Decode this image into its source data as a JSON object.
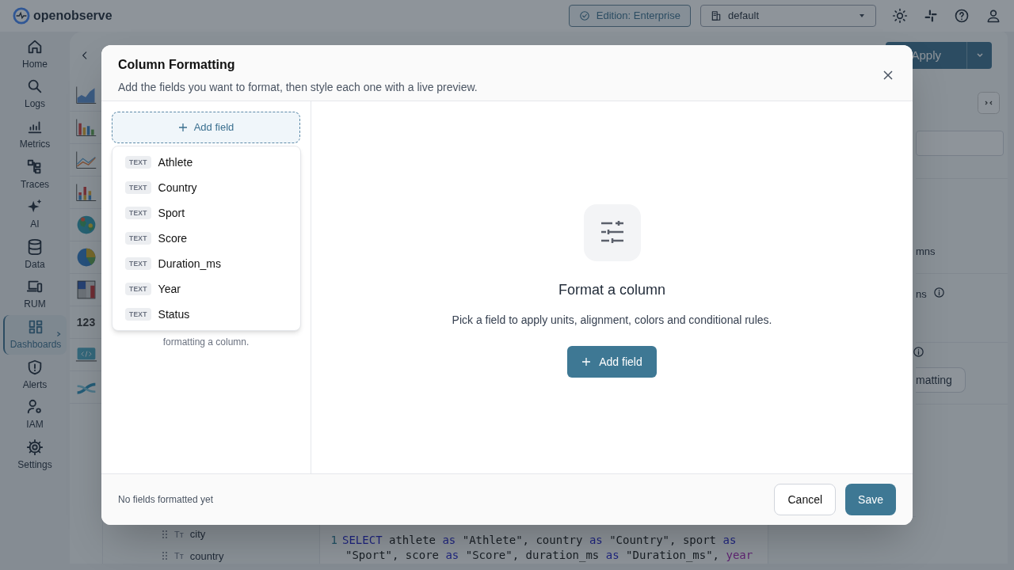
{
  "header": {
    "logo_text": "openobserve",
    "edition": "Edition: Enterprise",
    "org": "default"
  },
  "nav": [
    {
      "label": "Home",
      "selected": false
    },
    {
      "label": "Logs",
      "selected": false
    },
    {
      "label": "Metrics",
      "selected": false
    },
    {
      "label": "Traces",
      "selected": false
    },
    {
      "label": "AI",
      "selected": false
    },
    {
      "label": "Data",
      "selected": false
    },
    {
      "label": "RUM",
      "selected": false
    },
    {
      "label": "Dashboards",
      "selected": true
    },
    {
      "label": "Alerts",
      "selected": false
    },
    {
      "label": "IAM",
      "selected": false
    },
    {
      "label": "Settings",
      "selected": false
    }
  ],
  "toolbar": {
    "apply": "Apply"
  },
  "chart_types": [
    {
      "kind": "area"
    },
    {
      "kind": "bar"
    },
    {
      "kind": "line"
    },
    {
      "kind": "stacked"
    },
    {
      "kind": "geo"
    },
    {
      "kind": "pie"
    },
    {
      "kind": "heatmap"
    },
    {
      "kind": "metric",
      "text": "123"
    },
    {
      "kind": "html"
    },
    {
      "kind": "sankey"
    }
  ],
  "side_panel": {
    "texts": [
      "mns",
      "ns",
      "matting"
    ]
  },
  "field_list": [
    {
      "type": "Tт",
      "name": "city"
    },
    {
      "type": "Tт",
      "name": "country"
    }
  ],
  "query": {
    "line_number": "1",
    "lines": [
      [
        {
          "text": "SELECT",
          "kind": "keyword"
        },
        {
          "text": " athlete ",
          "kind": "plain"
        },
        {
          "text": "as",
          "kind": "keyword"
        },
        {
          "text": " \"Athlete\", country ",
          "kind": "plain"
        },
        {
          "text": "as",
          "kind": "keyword"
        },
        {
          "text": " \"Country\", sport ",
          "kind": "plain"
        },
        {
          "text": "as",
          "kind": "keyword"
        }
      ],
      [
        {
          "text": "\"Sport\", score ",
          "kind": "plain"
        },
        {
          "text": "as",
          "kind": "keyword"
        },
        {
          "text": " \"Score\", duration_ms ",
          "kind": "plain"
        },
        {
          "text": "as",
          "kind": "keyword"
        },
        {
          "text": " \"Duration_ms\", ",
          "kind": "plain"
        },
        {
          "text": "year",
          "kind": "function"
        }
      ]
    ]
  },
  "dialog": {
    "title": "Column Formatting",
    "subtitle": "Add the fields you want to format, then style each one with a live preview.",
    "add_field_dashed": "Add field",
    "field_options": [
      {
        "type": "TEXT",
        "name": "Athlete"
      },
      {
        "type": "TEXT",
        "name": "Country"
      },
      {
        "type": "TEXT",
        "name": "Sport"
      },
      {
        "type": "TEXT",
        "name": "Score"
      },
      {
        "type": "TEXT",
        "name": "Duration_ms"
      },
      {
        "type": "TEXT",
        "name": "Year"
      },
      {
        "type": "TEXT",
        "name": "Status"
      }
    ],
    "left_hint": "formatting a column.",
    "empty_title": "Format a column",
    "empty_text": "Pick a field to apply units, alignment, colors and conditional rules.",
    "add_field_button": "Add field",
    "footer_status": "No fields formatted yet",
    "cancel": "Cancel",
    "save": "Save"
  }
}
